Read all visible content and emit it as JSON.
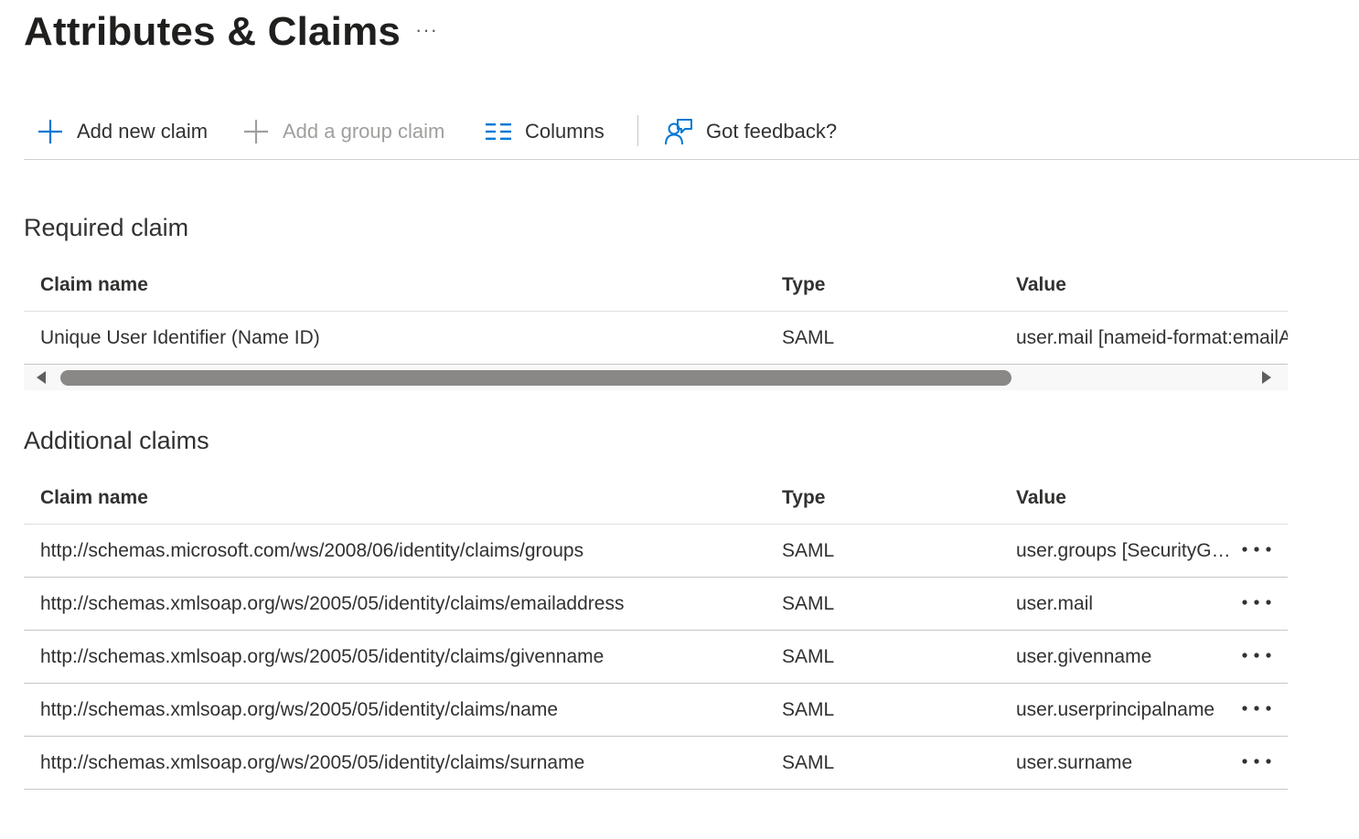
{
  "page": {
    "title": "Attributes & Claims",
    "more_label": "···"
  },
  "toolbar": {
    "add_new_claim": "Add new claim",
    "add_group_claim": "Add a group claim",
    "columns": "Columns",
    "feedback": "Got feedback?"
  },
  "required": {
    "section_title": "Required claim",
    "headers": {
      "name": "Claim name",
      "type": "Type",
      "value": "Value"
    },
    "rows": [
      {
        "name": "Unique User Identifier (Name ID)",
        "type": "SAML",
        "value": "user.mail [nameid-format:emailAddress]"
      }
    ]
  },
  "additional": {
    "section_title": "Additional claims",
    "headers": {
      "name": "Claim name",
      "type": "Type",
      "value": "Value"
    },
    "rows": [
      {
        "name": "http://schemas.microsoft.com/ws/2008/06/identity/claims/groups",
        "type": "SAML",
        "value": "user.groups [SecurityGroup]"
      },
      {
        "name": "http://schemas.xmlsoap.org/ws/2005/05/identity/claims/emailaddress",
        "type": "SAML",
        "value": "user.mail"
      },
      {
        "name": "http://schemas.xmlsoap.org/ws/2005/05/identity/claims/givenname",
        "type": "SAML",
        "value": "user.givenname"
      },
      {
        "name": "http://schemas.xmlsoap.org/ws/2005/05/identity/claims/name",
        "type": "SAML",
        "value": "user.userprincipalname"
      },
      {
        "name": "http://schemas.xmlsoap.org/ws/2005/05/identity/claims/surname",
        "type": "SAML",
        "value": "user.surname"
      }
    ]
  },
  "icons": {
    "add": "plus-icon",
    "group": "plus-icon",
    "columns": "columns-icon",
    "feedback": "feedback-person-icon",
    "row_more": "more-horizontal-icon"
  },
  "colors": {
    "accent": "#0078d4",
    "disabled": "#a19f9d",
    "text": "#323130"
  }
}
